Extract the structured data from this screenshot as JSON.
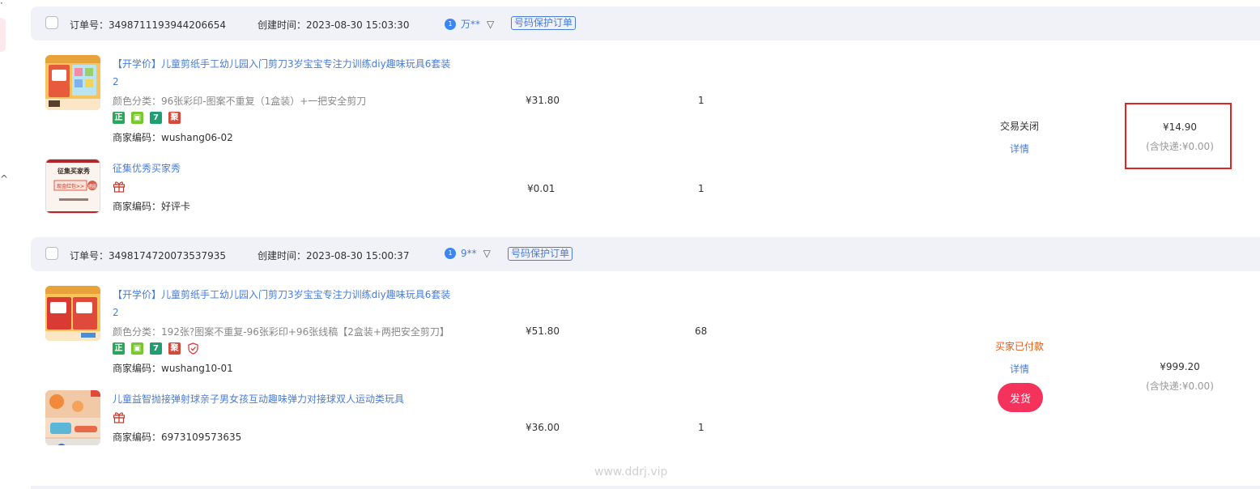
{
  "orders": [
    {
      "order_no": "订单号：3498711193944206654",
      "created": "创建时间：2023-08-30 15:03:30",
      "buyer": "万**",
      "protect_label": "号码保护订单",
      "status": "交易关闭",
      "detail_label": "详情",
      "total": "¥14.90",
      "shipping": "(含快递:¥0.00)",
      "items": [
        {
          "title": "【开学价】儿童剪纸手工幼儿园入门剪刀3岁宝宝专注力训练diy趣味玩具6套装2",
          "spec": "颜色分类：96张彩印-图案不重复（1盒装）+一把安全剪刀",
          "tags": [
            "正",
            "7",
            "聚"
          ],
          "sku": "商家编码：wushang06-02",
          "price": "¥31.80",
          "qty": "1"
        },
        {
          "title": "征集优秀买家秀",
          "sku": "商家编码：好评卡",
          "price": "¥0.01",
          "qty": "1",
          "thumb_text": [
            "征集买家秀",
            "现金红包>>",
            "晒图"
          ]
        }
      ]
    },
    {
      "order_no": "订单号：3498174720073537935",
      "created": "创建时间：2023-08-30 15:00:37",
      "buyer": "9**",
      "protect_label": "号码保护订单",
      "status": "买家已付款",
      "detail_label": "详情",
      "ship_button": "发货",
      "total": "¥999.20",
      "shipping": "(含快递:¥0.00)",
      "items": [
        {
          "title": "【开学价】儿童剪纸手工幼儿园入门剪刀3岁宝宝专注力训练diy趣味玩具6套装2",
          "spec": "颜色分类：192张?图案不重复-96张彩印+96张线稿【2盒装+两把安全剪刀】",
          "tags": [
            "正",
            "7",
            "聚"
          ],
          "sku": "商家编码：wushang10-01",
          "price": "¥51.80",
          "qty": "68"
        },
        {
          "title": "儿童益智抛接弹射球亲子男女孩互动趣味弹力对接球双人运动类玩具",
          "sku": "商家编码：6973109573635",
          "price": "¥36.00",
          "qty": "1"
        }
      ]
    }
  ],
  "watermark": "www.ddrj.vip",
  "colors": {
    "link": "#4a7cd6",
    "status_paid": "#e8590c",
    "ship_button": "#f5325c",
    "highlight": "#e02424",
    "header_bg": "#f0f2f8"
  }
}
